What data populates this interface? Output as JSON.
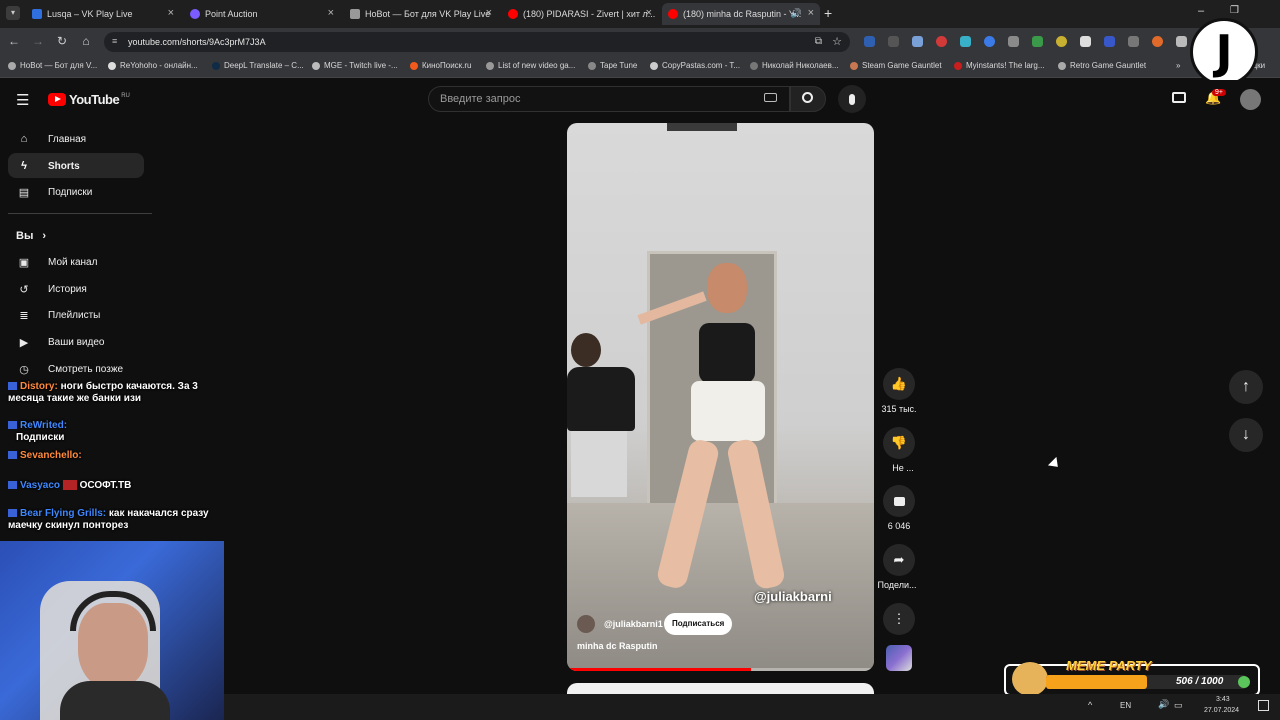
{
  "browser": {
    "tabs": [
      {
        "title": "Lusqa – VK Play Live",
        "color": "#2f6fe0"
      },
      {
        "title": "Point Auction",
        "color": "#7b5cff"
      },
      {
        "title": "HoBot — Бот для VK Play Live",
        "color": "#999999"
      },
      {
        "title": "(180) PIDARASI - Zivert | хит л...",
        "color": "#ff0000"
      },
      {
        "title": "(180) minha dc Rasputin - Y...",
        "color": "#ff0000"
      }
    ],
    "url": "youtube.com/shorts/9Ac3prM7J3A",
    "bookmarks": [
      "HoBot — Бот для V...",
      "ReYohoho - онлайн...",
      "DeepL Translate – C...",
      "MGE - Twitch live -...",
      "КиноПоиск.ru",
      "List of new video ga...",
      "Tape Tune",
      "CopyPastas.com - T...",
      "Николай Николаев...",
      "Steam Game Gauntlet",
      "Myinstants! The larg...",
      "Retro Game Gauntlet"
    ],
    "bookmarks_more": "адки",
    "logo_letter": "J"
  },
  "youtube": {
    "logo": "YouTube",
    "region": "RU",
    "search_placeholder": "Введите запрос",
    "notifications_badge": "9+",
    "sidebar": {
      "main": [
        "Главная",
        "Shorts",
        "Подписки"
      ],
      "you_header": "Вы",
      "you_items": [
        "Мой канал",
        "История",
        "Плейлисты",
        "Ваши видео",
        "Смотреть позже"
      ]
    },
    "short": {
      "watermark": "@juliakbarni",
      "channel": "@juliakbarni1",
      "subscribe": "Подписаться",
      "title": "minha dc Rasputin",
      "progress": 0.6,
      "likes": "315 тыс.",
      "dislike_label": "Не ...",
      "comments": "6 046",
      "share_label": "Подели..."
    }
  },
  "chat_overlay": [
    {
      "name": "Distory:",
      "text": "ноги быстро качаются. За 3 месяца такие же банки изи",
      "name_color": "orange"
    },
    {
      "name": "ReWrited:",
      "text": "Подписки"
    },
    {
      "name": "Sevanchello:",
      "text": "",
      "name_color": "orange"
    },
    {
      "name": "Vasyaco",
      "text": "ОСОФТ.ТВ"
    },
    {
      "name": "Bear Flying Grills:",
      "text": "как накачался сразу маечку скинул понторез"
    }
  ],
  "widget": {
    "title": "MEME PARTY",
    "progress_text": "506 / 1000",
    "progress": 0.506
  },
  "taskbar": {
    "lang": "EN",
    "time": "3:43",
    "date": "27.07.2024"
  },
  "colors": {
    "accent_red": "#ff0000",
    "yt_bg": "#0f0f0f",
    "widget_orange": "#f7a21b"
  }
}
